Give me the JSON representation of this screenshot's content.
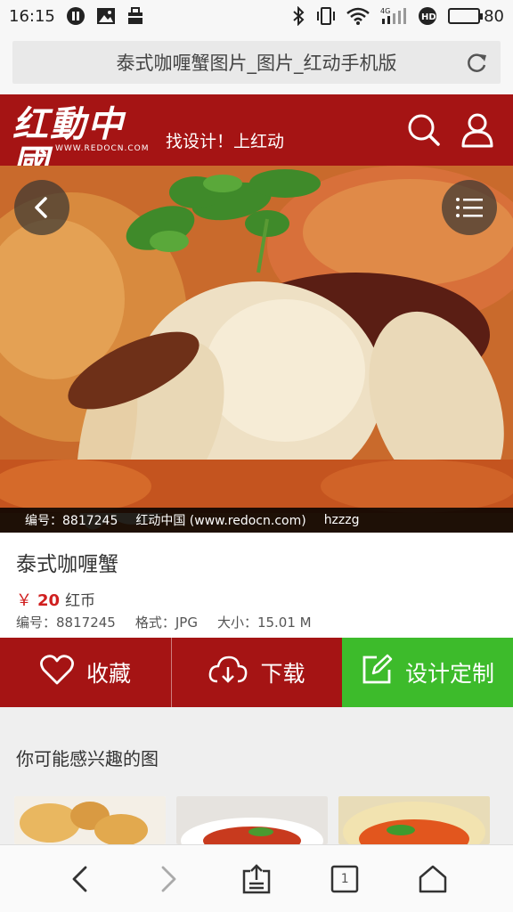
{
  "status_bar": {
    "time": "16:15",
    "battery": "80",
    "battery_level": 0.8,
    "icons": [
      "pause-icon",
      "image-icon",
      "bag-icon",
      "bluetooth-icon",
      "vibrate-icon",
      "wifi-icon",
      "signal-4g-icon",
      "hd-icon",
      "battery-icon"
    ]
  },
  "browser": {
    "page_title": "泰式咖喱蟹图片_图片_红动手机版"
  },
  "header": {
    "logo_text": "红動中國",
    "logo_domain": "WWW.REDOCN.COM",
    "slogan": "找设计！上红动",
    "brand_color": "#a51414"
  },
  "hero": {
    "caption_id": "编号：8817245",
    "caption_site": "红动中国 (www.redocn.com)",
    "caption_user": "hzzzg"
  },
  "product": {
    "title": "泰式咖喱蟹",
    "price_symbol": "￥",
    "price_value": "20",
    "price_unit": "红币",
    "id_label": "编号：",
    "id_value": "8817245",
    "format_label": "格式：",
    "format_value": "JPG",
    "size_label": "大小：",
    "size_value": "15.01 M"
  },
  "actions": {
    "favorite": "收藏",
    "download": "下载",
    "custom_design": "设计定制",
    "green_color": "#3dbb2b"
  },
  "recommendations": {
    "title": "你可能感兴趣的图"
  },
  "bottom_nav": {
    "tab_count": "1"
  }
}
